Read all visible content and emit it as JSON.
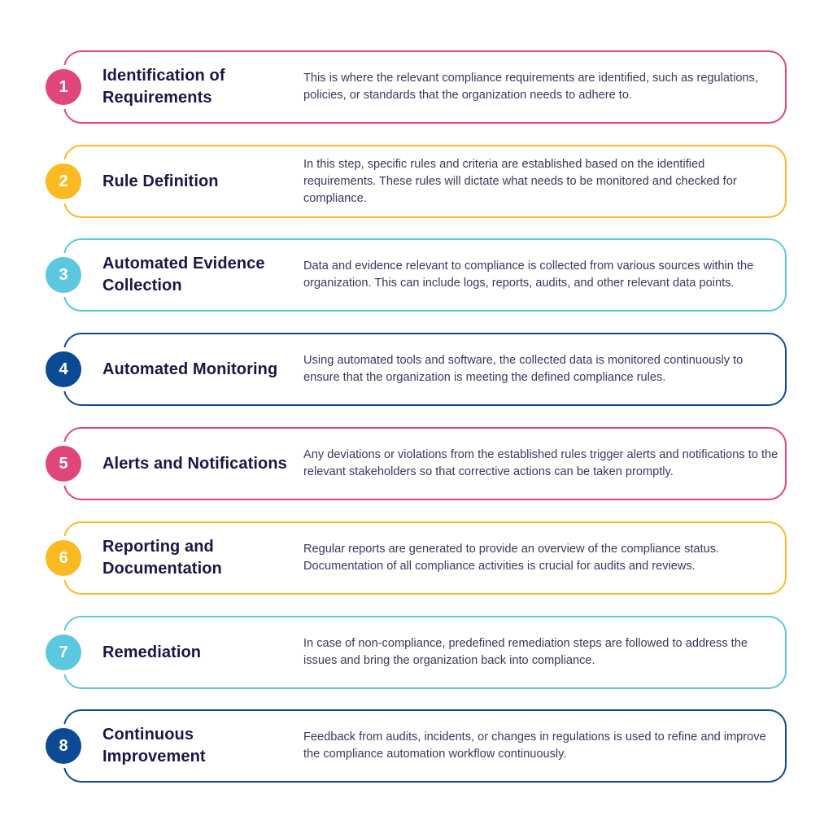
{
  "steps": [
    {
      "number": "1",
      "color": "#e0457b",
      "title": "Identification of Requirements",
      "description": "This is where the relevant compliance requirements are identified, such as regulations, policies, or standards that the organization needs to adhere to."
    },
    {
      "number": "2",
      "color": "#fbba22",
      "title": "Rule Definition",
      "description": "In this step, specific rules and criteria are established based on the identified requirements. These rules will dictate what needs to be monitored and checked for compliance."
    },
    {
      "number": "3",
      "color": "#5bc8e0",
      "title": "Automated Evidence Collection",
      "description": "Data and evidence relevant to compliance is collected from various sources within the organization. This can include logs, reports, audits, and other relevant data points."
    },
    {
      "number": "4",
      "color": "#0c4a94",
      "title": "Automated Monitoring",
      "description": "Using automated tools and software, the collected data is monitored continuously to ensure that the organization is meeting the defined compliance rules."
    },
    {
      "number": "5",
      "color": "#e0457b",
      "title": "Alerts and Notifications",
      "description": "Any deviations or violations from the established rules trigger alerts and notifications to the relevant stakeholders so that corrective actions can be taken promptly."
    },
    {
      "number": "6",
      "color": "#fbba22",
      "title": "Reporting and Documentation",
      "description": "Regular reports are generated to provide an overview of the compliance status. Documentation of all compliance activities is crucial for audits and reviews."
    },
    {
      "number": "7",
      "color": "#5bc8e0",
      "title": "Remediation",
      "description": "In case of non-compliance, predefined remediation steps are followed to address the issues and bring the organization back into compliance."
    },
    {
      "number": "8",
      "color": "#0c4a94",
      "title": "Continuous Improvement",
      "description": "Feedback from audits, incidents, or changes in regulations is used to refine and improve the compliance automation workflow continuously."
    }
  ]
}
